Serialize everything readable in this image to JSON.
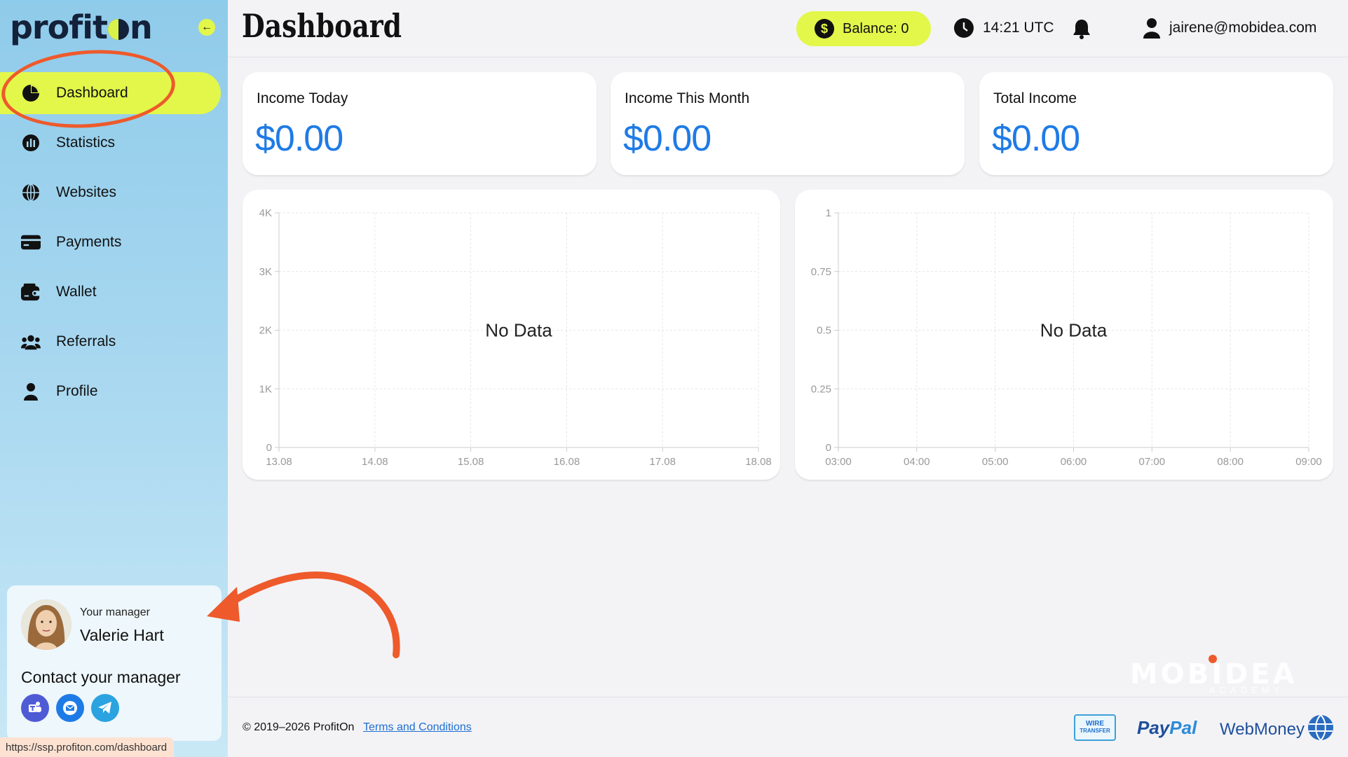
{
  "app": {
    "logo_text": "profit",
    "logo_suffix": "n"
  },
  "sidebar": {
    "items": [
      {
        "label": "Dashboard",
        "icon": "pie-chart-icon",
        "active": true
      },
      {
        "label": "Statistics",
        "icon": "bar-stats-icon"
      },
      {
        "label": "Websites",
        "icon": "globe-icon"
      },
      {
        "label": "Payments",
        "icon": "card-icon"
      },
      {
        "label": "Wallet",
        "icon": "wallet-icon"
      },
      {
        "label": "Referrals",
        "icon": "users-icon"
      },
      {
        "label": "Profile",
        "icon": "user-icon"
      }
    ],
    "manager": {
      "role": "Your manager",
      "name": "Valerie Hart",
      "contact_label": "Contact your manager",
      "contacts": [
        "teams-icon",
        "email-icon",
        "telegram-icon"
      ]
    }
  },
  "header": {
    "title": "Dashboard",
    "balance": "Balance: 0",
    "time": "14:21 UTC",
    "user_email": "jairene@mobidea.com"
  },
  "stats": [
    {
      "label": "Income Today",
      "value": "$0.00"
    },
    {
      "label": "Income This Month",
      "value": "$0.00"
    },
    {
      "label": "Total Income",
      "value": "$0.00"
    }
  ],
  "chart_data": [
    {
      "type": "line",
      "x": [
        "13.08",
        "14.08",
        "15.08",
        "16.08",
        "17.08",
        "18.08"
      ],
      "yticks": [
        "0",
        "1K",
        "2K",
        "3K",
        "4K"
      ],
      "ylim": [
        0,
        4000
      ],
      "series": [],
      "annotation": "No Data",
      "grid": true
    },
    {
      "type": "line",
      "x": [
        "03:00",
        "04:00",
        "05:00",
        "06:00",
        "07:00",
        "08:00",
        "09:00"
      ],
      "yticks": [
        "0",
        "0.25",
        "0.5",
        "0.75",
        "1"
      ],
      "ylim": [
        0,
        1
      ],
      "series": [],
      "annotation": "No Data",
      "grid": true
    }
  ],
  "footer": {
    "copyright": "© 2019–2026 ProfitOn",
    "terms": "Terms and Conditions",
    "wire_top": "WIRE",
    "wire_bottom": "TRANSFER",
    "paypal_a": "Pay",
    "paypal_b": "Pal",
    "webmoney": "WebMoney"
  },
  "status_bar": {
    "url": "https://ssp.profiton.com/dashboard"
  },
  "watermark": {
    "brand": "MOBIDEA",
    "sub": "ACADEMY"
  },
  "colors": {
    "accent": "#e2f74a",
    "value_blue": "#1e7be6",
    "annotation": "#ee5a2b"
  }
}
